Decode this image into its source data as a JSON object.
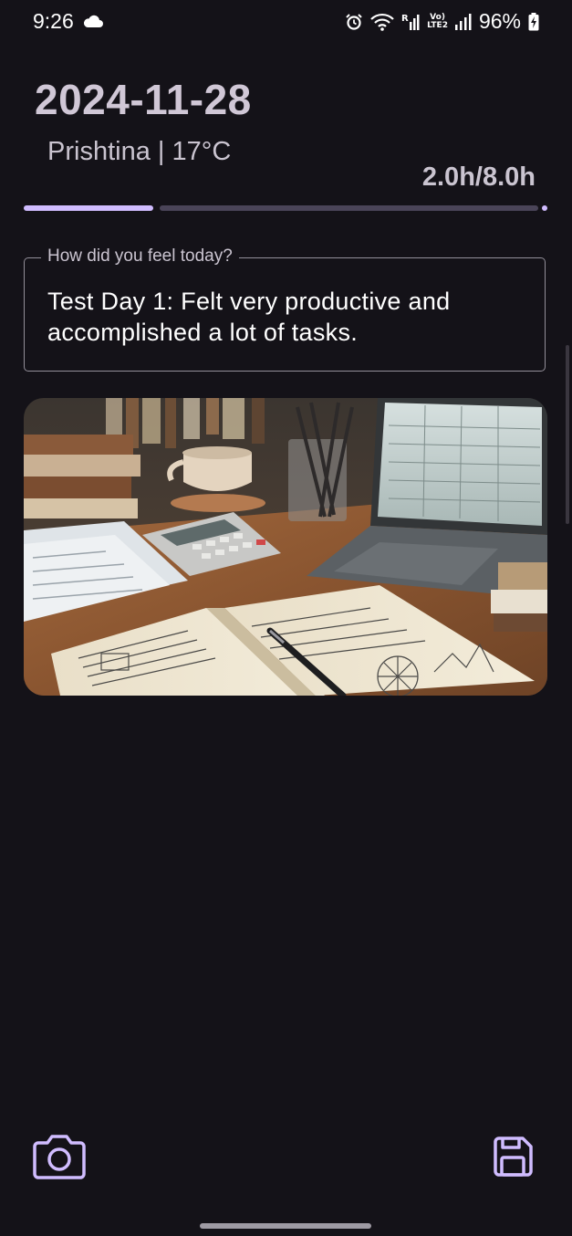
{
  "status_bar": {
    "time": "9:26",
    "battery": "96%",
    "icons": [
      "cloud-icon",
      "alarm-icon",
      "wifi-icon",
      "signal-r-icon",
      "volte-lte2-icon",
      "signal-icon",
      "battery-charging-icon"
    ]
  },
  "header": {
    "date": "2024-11-28",
    "location_weather": "Prishtina | 17°C",
    "hours": "2.0h/8.0h"
  },
  "progress": {
    "value": 0.25,
    "color": "#d0bcff",
    "track_color": "#4a4458"
  },
  "feeling_field": {
    "label": "How did you feel today?",
    "value": "Test Day 1: Felt very productive and accomplished a lot of tasks."
  },
  "photo": {
    "subject": "desk with notebook, calculator, laptop, books and coffee cup"
  },
  "actions": {
    "camera_icon": "camera-icon",
    "save_icon": "save-icon",
    "accent": "#d0bcff"
  }
}
